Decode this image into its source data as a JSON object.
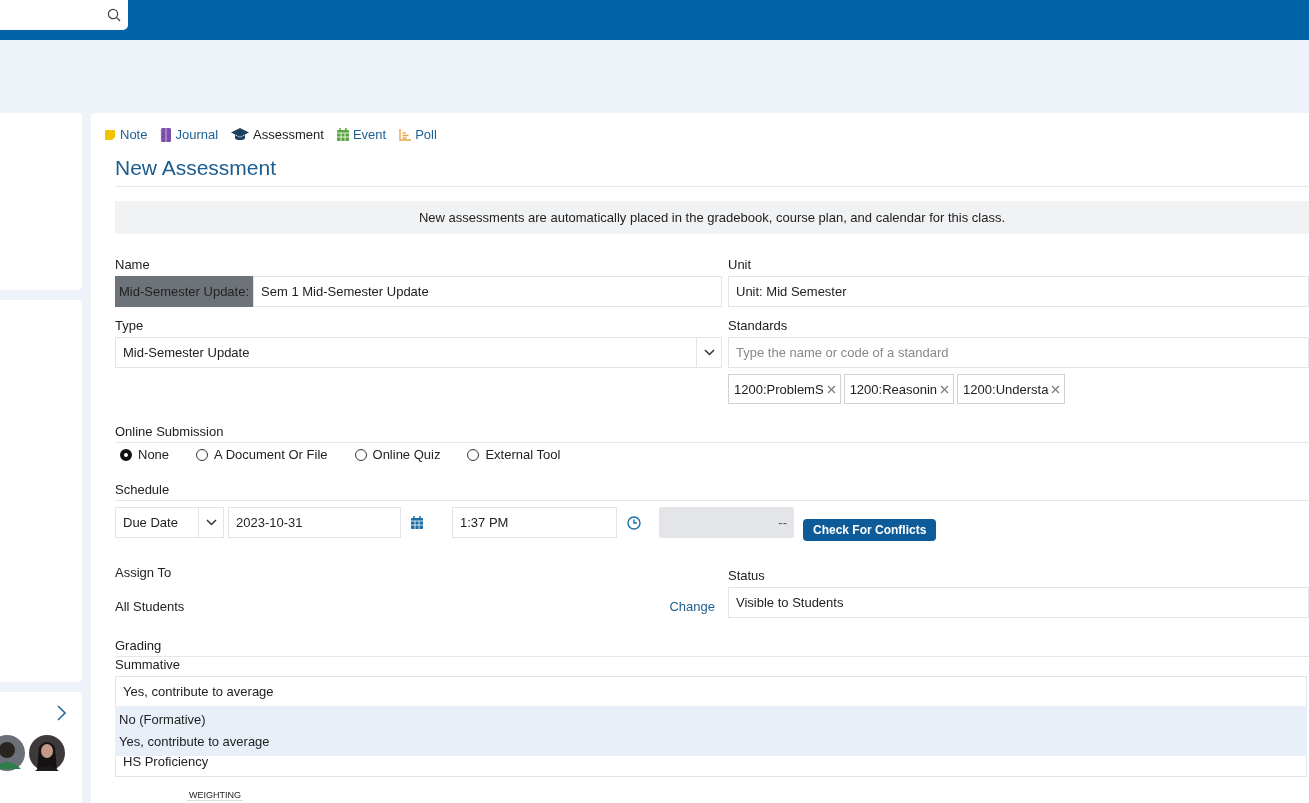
{
  "entry_types": [
    {
      "label": "Note",
      "selected": false
    },
    {
      "label": "Journal",
      "selected": false
    },
    {
      "label": "Assessment",
      "selected": true
    },
    {
      "label": "Event",
      "selected": false
    },
    {
      "label": "Poll",
      "selected": false
    }
  ],
  "heading": "New Assessment",
  "notice": "New assessments are automatically placed in the gradebook, course plan, and calendar for this class.",
  "name": {
    "label": "Name",
    "prefix": "Mid-Semester Update:",
    "value": "Sem 1 Mid-Semester Update"
  },
  "unit": {
    "label": "Unit",
    "value": "Unit: Mid Semester"
  },
  "type": {
    "label": "Type",
    "value": "Mid-Semester Update"
  },
  "standards": {
    "label": "Standards",
    "placeholder": "Type the name or code of a standard",
    "tags": [
      "1200:ProblemS",
      "1200:Reasonin",
      "1200:Understa"
    ]
  },
  "online_submission": {
    "label": "Online Submission",
    "options": [
      {
        "label": "None",
        "selected": true
      },
      {
        "label": "A Document Or File",
        "selected": false
      },
      {
        "label": "Online Quiz",
        "selected": false
      },
      {
        "label": "External Tool",
        "selected": false
      }
    ]
  },
  "schedule": {
    "label": "Schedule",
    "mode": "Due Date",
    "date": "2023-10-31",
    "time": "1:37 PM",
    "end": "--",
    "button": "Check For Conflicts"
  },
  "assign_to": {
    "label": "Assign To",
    "value": "All Students",
    "link": "Change"
  },
  "status": {
    "label": "Status",
    "value": "Visible to Students"
  },
  "grading": {
    "label": "Grading",
    "summative_label": "Summative",
    "summative_value": "Yes, contribute to average",
    "dropdown_options": [
      "No (Formative)",
      "Yes, contribute to average"
    ],
    "scale_value": "HS Proficiency",
    "weighting_label": "WEIGHTING"
  }
}
